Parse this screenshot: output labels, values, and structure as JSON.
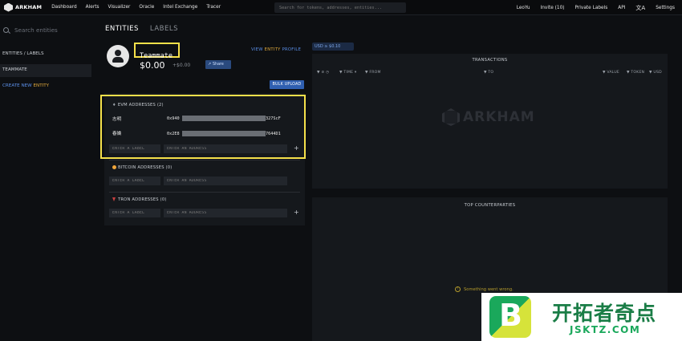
{
  "nav": {
    "brand": "ARKHAM",
    "links": [
      "Dashboard",
      "Alerts",
      "Visualizer",
      "Oracle",
      "Intel Exchange",
      "Tracer"
    ],
    "search_placeholder": "Search for tokens, addresses, entities...",
    "right": [
      "LeoYu",
      "Invite (10)",
      "Private Labels",
      "API"
    ],
    "translate_glyph": "文A",
    "settings": "Settings"
  },
  "sidebar": {
    "search_placeholder": "Search entities",
    "items": [
      "ENTITIES / LABELS",
      "TEAMMATE"
    ],
    "create_prefix": "CREATE NEW ",
    "create_highlight": "ENTITY"
  },
  "tabs": [
    "ENTITIES",
    "LABELS"
  ],
  "entity": {
    "name": "Teammate",
    "view_prefix": "VIEW ",
    "view_highlight": "ENTITY",
    "view_suffix": " PROFILE",
    "balance": "$0.00",
    "change": "+$0.00",
    "share_label": "Share",
    "bulk_upload": "BULK UPLOAD"
  },
  "evm": {
    "title": "EVM ADDRESSES (2)",
    "icon": "♦",
    "addresses": [
      {
        "label": "志明",
        "start": "0x940",
        "end": "327ScF"
      },
      {
        "label": "春嬌",
        "start": "0x2E8",
        "end": "7644D1"
      }
    ],
    "label_placeholder": "ENTER A LABEL",
    "address_placeholder": "ENTER AN ADDRESS",
    "add": "+"
  },
  "bitcoin": {
    "title": "BITCOIN ADDRESSES (0)",
    "label_placeholder": "ENTER A LABEL",
    "address_placeholder": "ENTER AN ADDRESS"
  },
  "tron": {
    "title": "TRON ADDRESSES (0)",
    "label_placeholder": "ENTER A LABEL",
    "address_placeholder": "ENTER AN ADDRESS",
    "add": "+"
  },
  "usd_chip": "USD ≥ $0.10",
  "transactions": {
    "title": "TRANSACTIONS",
    "columns": [
      "TIME",
      "FROM",
      "TO",
      "VALUE",
      "TOKEN",
      "USD"
    ],
    "watermark": "ARKHAM"
  },
  "counterparties": {
    "title": "TOP COUNTERPARTIES",
    "error": "Something went wrong."
  },
  "promo": {
    "logo_letter": "B",
    "title": "开拓者奇点",
    "url": "JSKTZ.COM"
  }
}
